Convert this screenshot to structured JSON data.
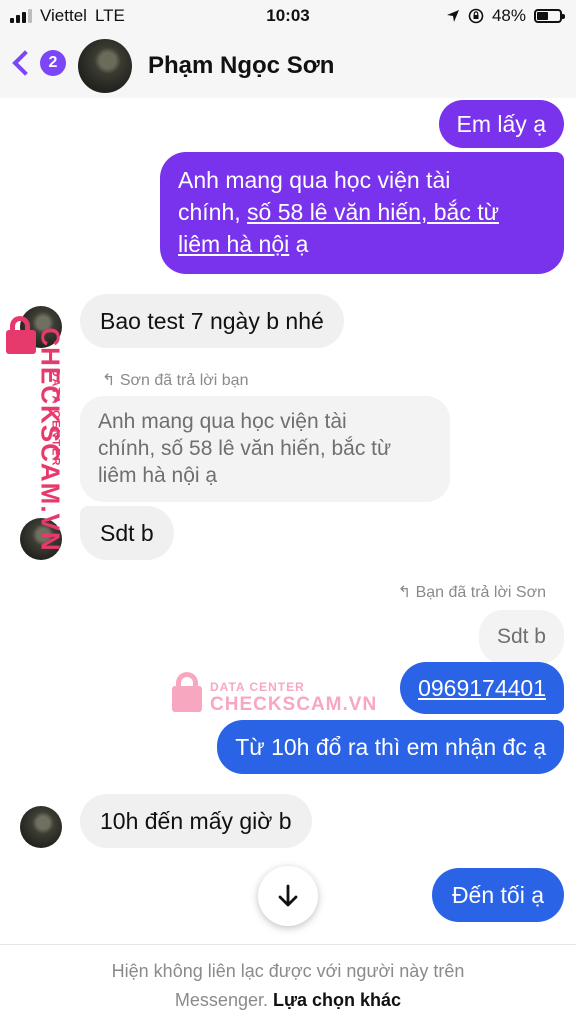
{
  "status": {
    "carrier": "Viettel",
    "network": "LTE",
    "time": "10:03",
    "battery_percent": "48%",
    "battery_level": 0.48
  },
  "header": {
    "back_badge": "2",
    "contact_name": "Phạm Ngọc Sơn"
  },
  "messages": {
    "m1": "Em lấy ạ",
    "m2_line1": "Anh mang qua học viện tài",
    "m2_line2_a": "chính, ",
    "m2_line2_b": "số 58 lê văn hiến, bắc từ",
    "m2_line3_a": "liêm hà nội",
    "m2_line3_b": " ạ",
    "m3": "Bao test 7 ngày b nhé",
    "reply_note_1": "Sơn đã trả lời bạn",
    "quote1_line1": "Anh mang qua học viện tài",
    "quote1_line2": "chính, số 58 lê văn hiến, bắc từ",
    "quote1_line3": "liêm hà nội ạ",
    "m4": "Sdt b",
    "reply_note_2": "Bạn đã trả lời Sơn",
    "quote2": "Sdt b",
    "m5": "0969174401",
    "m6": "Từ 10h đổ ra thì em nhận đc ạ",
    "m7": "10h đến mấy giờ b",
    "m8": "Đến tối ạ"
  },
  "watermark": {
    "small": "DATA CENTER",
    "big": "CHECKSCAM.VN"
  },
  "footer": {
    "text_line1": "Hiện không liên lạc được với người này trên",
    "text_line2": "Messenger.",
    "link": "Lựa chọn khác"
  },
  "icons": {
    "back": "chevron-left-icon",
    "scroll": "arrow-down-icon",
    "reply": "reply-arrow-icon",
    "location": "location-arrow-icon",
    "rotation_lock": "rotation-lock-icon"
  },
  "colors": {
    "purple": "#7a33ed",
    "blue": "#2b63e6",
    "incoming": "#f0f0f0"
  }
}
